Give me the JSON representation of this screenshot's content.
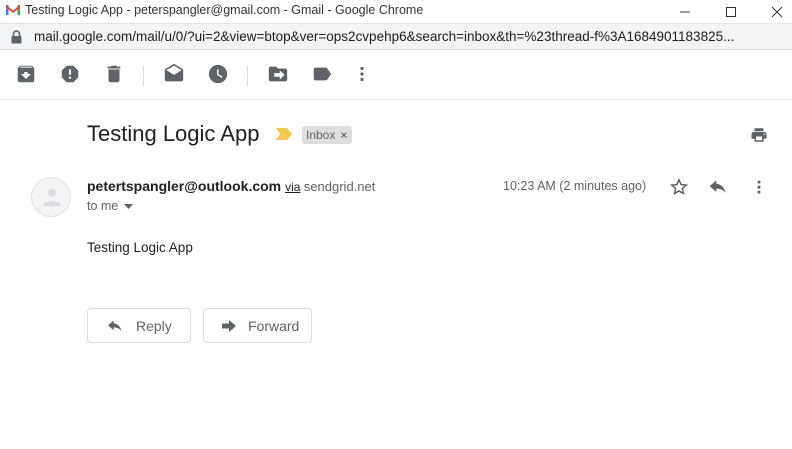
{
  "window": {
    "title": "Testing Logic App - peterspangler@gmail.com - Gmail - Google Chrome"
  },
  "address_bar": {
    "url": "mail.google.com/mail/u/0/?ui=2&view=btop&ver=ops2cvpehp6&search=inbox&th=%23thread-f%3A1684901183825..."
  },
  "toolbar": {
    "icons": [
      "archive-icon",
      "report-spam-icon",
      "delete-icon",
      "mark-unread-icon",
      "snooze-icon",
      "move-to-icon",
      "labels-icon",
      "more-vert-icon"
    ]
  },
  "message": {
    "subject": "Testing Logic App",
    "label": "Inbox",
    "label_remove": "×",
    "sender": "petertspangler@outlook.com",
    "via_word": "via",
    "via_domain": "sendgrid.net",
    "recipient": "to me",
    "timestamp": "10:23 AM (2 minutes ago)",
    "body": "Testing Logic App"
  },
  "actions": {
    "reply_label": "Reply",
    "forward_label": "Forward"
  },
  "colors": {
    "icon": "#5f6368",
    "importance_marker": "#f2c94c",
    "label_chip": "#dddddd"
  }
}
